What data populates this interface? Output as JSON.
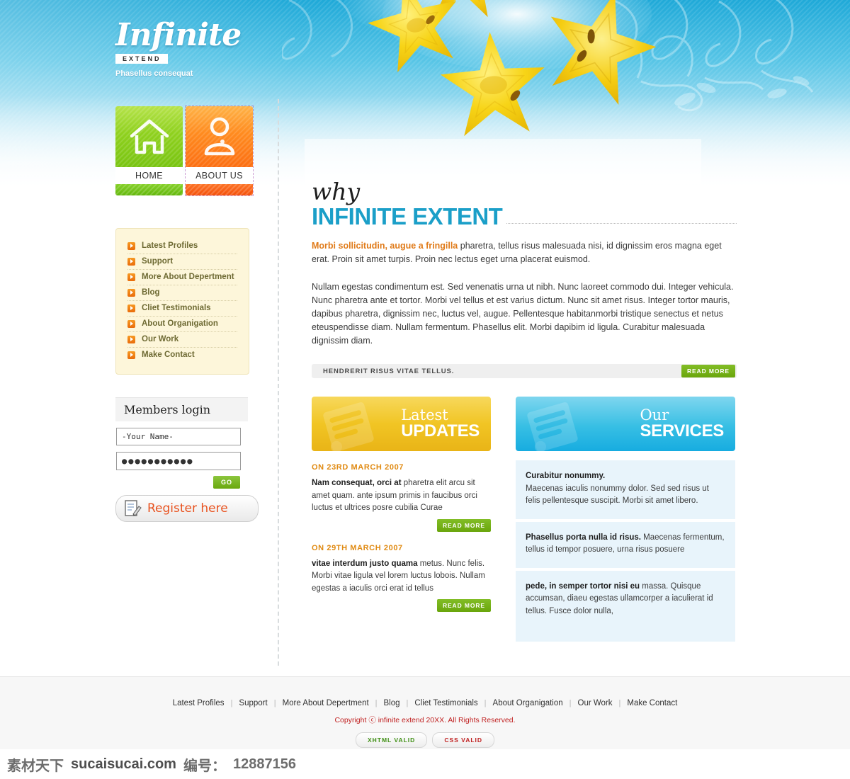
{
  "header": {
    "logo_word": "Infinite",
    "logo_badge": "EXTEND",
    "tagline": "Phasellus consequat"
  },
  "nav": {
    "buttons": [
      {
        "label": "HOME",
        "icon": "home-icon",
        "color": "#8fd11e"
      },
      {
        "label": "ABOUT US",
        "icon": "user-icon",
        "color": "#fc6f13"
      }
    ]
  },
  "sidebar": {
    "menu": [
      {
        "label": "Latest Profiles"
      },
      {
        "label": "Support"
      },
      {
        "label": "More About Depertment"
      },
      {
        "label": "Blog"
      },
      {
        "label": "Cliet Testimonials"
      },
      {
        "label": "About Organigation"
      },
      {
        "label": "Our Work"
      },
      {
        "label": "Make Contact"
      }
    ],
    "login": {
      "title": "Members login",
      "username_value": "-Your Name-",
      "username_placeholder": "-Your Name-",
      "password_value": "●●●●●●●●●●●",
      "go_label": "GO",
      "register_label": "Register here",
      "register_icon": "form-pencil-icon"
    }
  },
  "main": {
    "kicker": "why",
    "title": "INFINITE EXTENT",
    "lead_bold": "Morbi sollicitudin, augue a fringilla",
    "lead_rest": " pharetra, tellus risus malesuada nisi, id dignissim eros magna eget erat. Proin sit amet turpis. Proin nec lectus eget urna placerat euismod.",
    "body": "Nullam egestas condimentum est. Sed venenatis urna ut nibh. Nunc laoreet commodo dui. Integer vehicula. Nunc pharetra ante et tortor. Morbi vel tellus et est varius dictum. Nunc sit amet risus. Integer tortor mauris, dapibus pharetra, dignissim nec, luctus vel, augue. Pellentesque habitanmorbi tristique senectus et netus eteuspendisse diam. Nullam fermentum. Phasellus elit. Morbi dapibim id ligula. Curabitur malesuada dignissim diam.",
    "strip": {
      "text": "HENDRERIT RISUS VITAE TELLUS.",
      "read_more": "READ MORE"
    }
  },
  "updates": {
    "title_light": "Latest",
    "title_bold": "UPDATES",
    "icon": "list-document-icon",
    "posts": [
      {
        "date": "ON 23RD MARCH 2007",
        "bold": "Nam consequat, orci at",
        "text": " pharetra elit arcu sit amet quam. ante ipsum primis in faucibus orci luctus et ultrices posre cubilia Curae",
        "read_more": "READ MORE"
      },
      {
        "date": "ON 29TH MARCH 2007",
        "bold": "vitae interdum justo quama",
        "text": " metus. Nunc felis. Morbi vitae ligula vel lorem luctus lobois. Nullam egestas a iaculis orci erat id tellus",
        "read_more": "READ MORE"
      }
    ]
  },
  "services": {
    "title_light": "Our",
    "title_bold": "SERVICES",
    "icon": "list-document-icon",
    "items": [
      {
        "bold": "Curabitur nonummy.",
        "text": " Maecenas iaculis nonummy dolor. Sed sed risus ut felis pellentesque suscipit. Morbi sit amet libero."
      },
      {
        "bold": "Phasellus porta nulla id risus.",
        "text": " Maecenas fermentum, tellus id tempor posuere, urna risus posuere"
      },
      {
        "bold": "pede, in semper tortor nisi eu",
        "text": " massa. Quisque accumsan, diaeu egestas ullamcorper a iaculierat id tellus. Fusce dolor nulla,"
      }
    ]
  },
  "footer": {
    "links": [
      "Latest Profiles",
      "Support",
      "More About Depertment",
      "Blog",
      "Cliet Testimonials",
      "About Organigation",
      "Our Work",
      "Make Contact"
    ],
    "separator": "|",
    "copyright": "Copyright ⓒ infinite extend 20XX. All Rights Reserved.",
    "badges": [
      {
        "label": "XHTML VALID",
        "color": "#3f8f14"
      },
      {
        "label": "CSS VALID",
        "color": "#c02020"
      }
    ]
  },
  "watermark": {
    "brand": "素材天下",
    "site": "sucaisucai.com",
    "id_label": "编号：",
    "id_value": "12887156"
  },
  "colors": {
    "hero_blue": "#1fa9d8",
    "title_blue": "#1b9fc8",
    "accent_orange": "#e07b1a",
    "green": "#6aa60c",
    "gold": "#f1c524"
  }
}
